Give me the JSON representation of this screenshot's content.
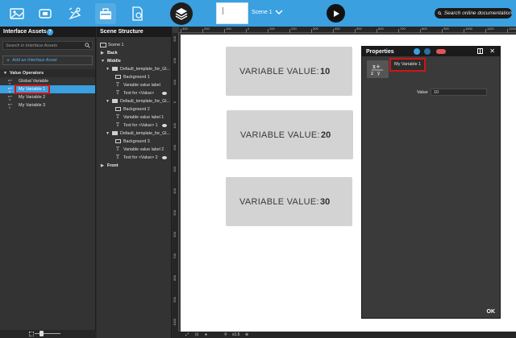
{
  "toolbar": {
    "scene_name": "Scene 1",
    "search_placeholder": "Search online documentation",
    "buttons": [
      "image-icon",
      "crop-icon",
      "effects-icon",
      "toolbox-icon",
      "page-icon",
      "layers-icon"
    ]
  },
  "interface_assets": {
    "title": "Interface Assets",
    "help": "?",
    "search_placeholder": "Search in Interface Assets",
    "add_label": "Add an Interface Asset",
    "group": "Value Operators",
    "items": [
      {
        "label": "Global Variable",
        "selected": false
      },
      {
        "label": "My Variable 1",
        "selected": true
      },
      {
        "label": "My Variable 2",
        "selected": false
      },
      {
        "label": "My Variable 3",
        "selected": false
      }
    ]
  },
  "scene_structure": {
    "title": "Scene Structure",
    "root": "Scene 1",
    "layers": {
      "back": "Back",
      "middle": "Middle",
      "front": "Front"
    },
    "templates": [
      {
        "name": "Default_template_for_Gl...",
        "background": "Background 1",
        "label": "Variable value label",
        "text": "Text for <Value>"
      },
      {
        "name": "Default_template_for_Gl...",
        "background": "Background 2",
        "label": "Variable value label 1",
        "text": "Text for <Value> 1"
      },
      {
        "name": "Default_template_for_Gl...",
        "background": "Background 3",
        "label": "Variable value label 2",
        "text": "Text for <Value> 2"
      }
    ]
  },
  "rulers": {
    "top": [
      "300",
      "200",
      "100",
      "0",
      "100",
      "200",
      "300",
      "400",
      "500",
      "600",
      "700",
      "800",
      "900",
      "1000",
      "1100",
      "1200",
      "1300",
      "1400"
    ],
    "left": [
      "300",
      "200",
      "100",
      "0",
      "100",
      "200",
      "300",
      "400",
      "500",
      "600",
      "700",
      "800",
      "900",
      "1000",
      "1100",
      "1200",
      "1300",
      "1400"
    ]
  },
  "canvas": {
    "cards": [
      {
        "label": "VARIABLE VALUE:",
        "value": "10"
      },
      {
        "label": "VARIABLE VALUE:",
        "value": "20"
      },
      {
        "label": "VARIABLE VALUE:",
        "value": "30"
      }
    ],
    "footer_zoom": "x1.6"
  },
  "properties": {
    "title": "Properties",
    "name": "My Variable 1",
    "value_label": "Value",
    "value": "10",
    "ok_label": "OK"
  },
  "colors": {
    "accent": "#3aa0e0",
    "highlight": "#d01515",
    "panel": "#333333",
    "card": "#d3d3d3"
  }
}
